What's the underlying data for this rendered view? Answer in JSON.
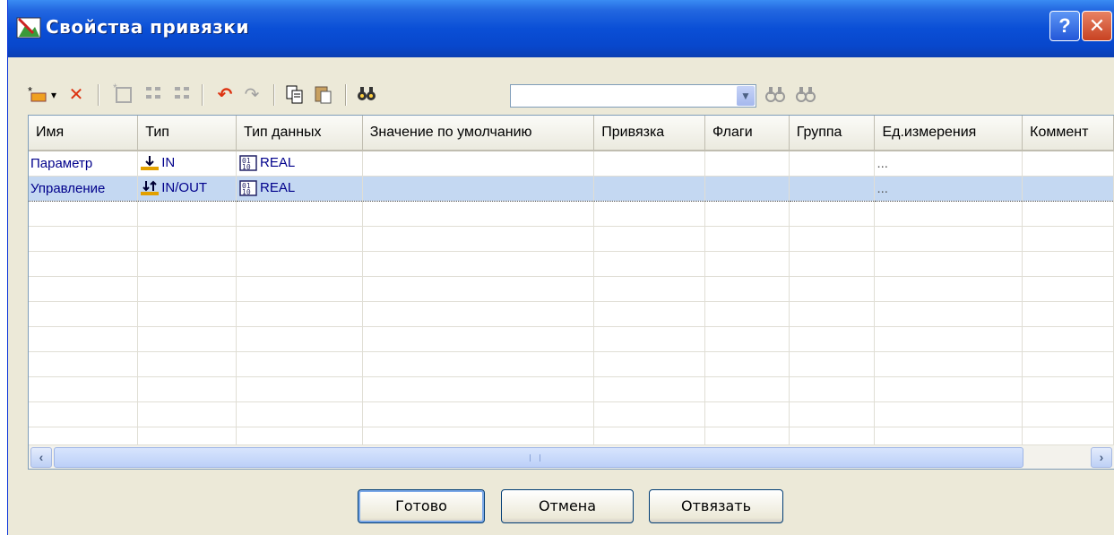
{
  "window": {
    "title": "Свойства привязки"
  },
  "toolbar": {
    "search_value": ""
  },
  "table": {
    "columns": [
      "Имя",
      "Тип",
      "Тип данных",
      "Значение по умолчанию",
      "Привязка",
      "Флаги",
      "Группа",
      "Ед.измерения",
      "Коммент"
    ],
    "rows": [
      {
        "name": "Параметр",
        "type": "IN",
        "datatype": "REAL",
        "default": "",
        "binding": "",
        "flags": "",
        "group": "",
        "units": "...",
        "comment": "",
        "selected": false
      },
      {
        "name": "Управление",
        "type": "IN/OUT",
        "datatype": "REAL",
        "default": "",
        "binding": "",
        "flags": "",
        "group": "",
        "units": "...",
        "comment": "",
        "selected": true
      }
    ]
  },
  "buttons": {
    "done": "Готово",
    "cancel": "Отмена",
    "unbind": "Отвязать"
  },
  "colors": {
    "title_bar": "#0a4fd6",
    "selection": "#c4d8f2",
    "face": "#ece9d8"
  }
}
